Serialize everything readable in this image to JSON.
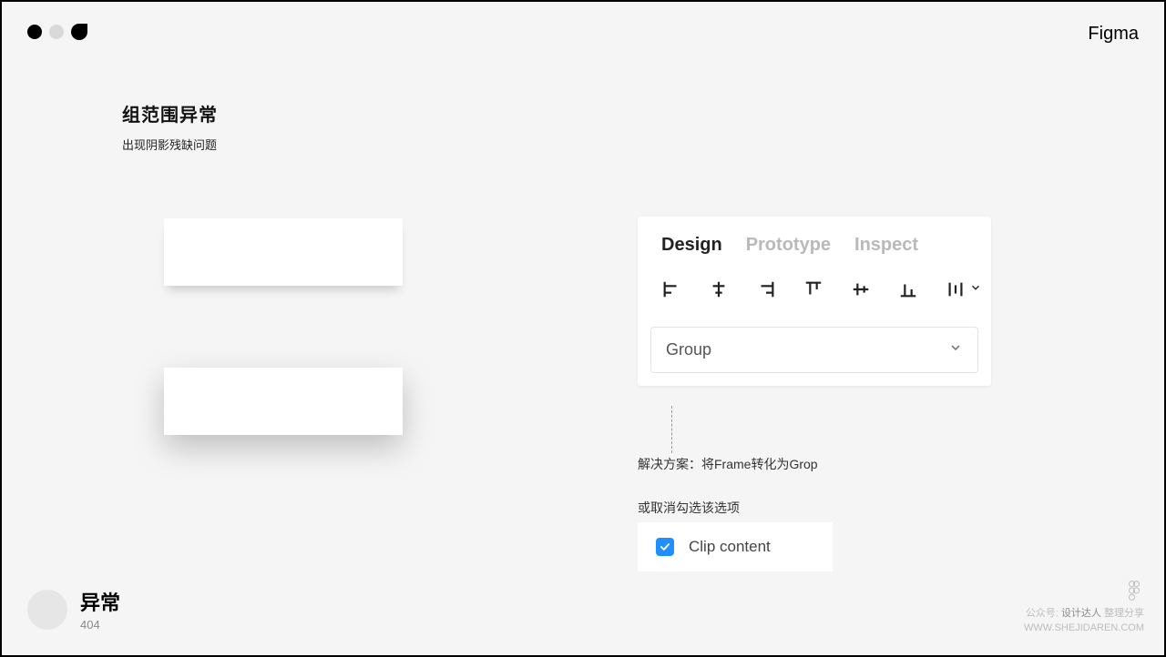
{
  "brand": "Figma",
  "heading": {
    "title": "组范围异常",
    "subtitle": "出现阴影残缺问题"
  },
  "panel": {
    "tabs": {
      "design": "Design",
      "prototype": "Prototype",
      "inspect": "Inspect"
    },
    "select_value": "Group"
  },
  "hints": {
    "solution": "解决方案：将Frame转化为Grop",
    "or_uncheck": "或取消勾选该选项"
  },
  "clip": {
    "label": "Clip content",
    "checked": true
  },
  "footer": {
    "title": "异常",
    "code": "404"
  },
  "watermark": {
    "line1_prefix": "公众号:",
    "line1_strong": "设计达人",
    "line1_suffix": " 整理分享",
    "line2": "WWW.SHEJIDAREN.COM"
  }
}
